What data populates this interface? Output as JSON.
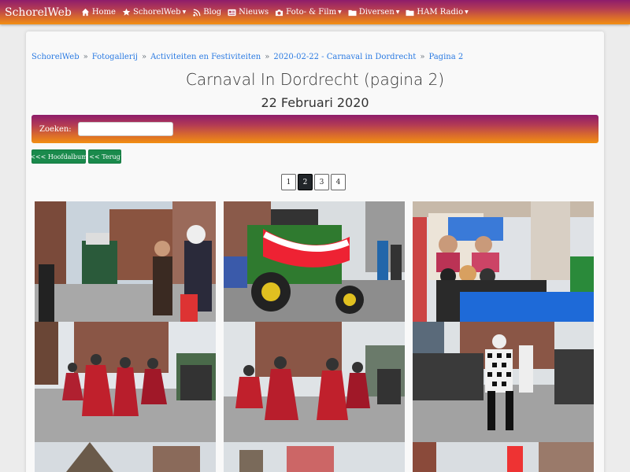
{
  "navbar": {
    "brand": "SchorelWeb",
    "items": [
      {
        "label": "Home",
        "icon": "home-icon",
        "dropdown": false
      },
      {
        "label": "SchorelWeb",
        "icon": "star-icon",
        "dropdown": true
      },
      {
        "label": "Blog",
        "icon": "rss-icon",
        "dropdown": false
      },
      {
        "label": "Nieuws",
        "icon": "newspaper-icon",
        "dropdown": false
      },
      {
        "label": "Foto- & Film",
        "icon": "camera-icon",
        "dropdown": true
      },
      {
        "label": "Diversen",
        "icon": "folder-icon",
        "dropdown": true
      },
      {
        "label": "HAM Radio",
        "icon": "folder-icon",
        "dropdown": true
      }
    ]
  },
  "breadcrumb": [
    "SchorelWeb",
    "Fotogallerij",
    "Activiteiten en Festiviteiten",
    "2020-02-22 - Carnaval in Dordrecht",
    "Pagina 2"
  ],
  "breadcrumb_sep": "»",
  "page": {
    "title": "Carnaval In Dordrecht (pagina 2)",
    "subtitle": "22 Februari 2020"
  },
  "search": {
    "label": "Zoeken:",
    "value": ""
  },
  "buttons": {
    "main_album": "<<< Hoofdalbum",
    "back": "<< Terug"
  },
  "pagination": {
    "pages": [
      "1",
      "2",
      "3",
      "4"
    ],
    "active": "2"
  },
  "colors": {
    "gradient_top": "#8e1d6b",
    "gradient_bottom": "#f28f12",
    "link": "#2a7ae2",
    "button_green": "#1a8a4c"
  }
}
